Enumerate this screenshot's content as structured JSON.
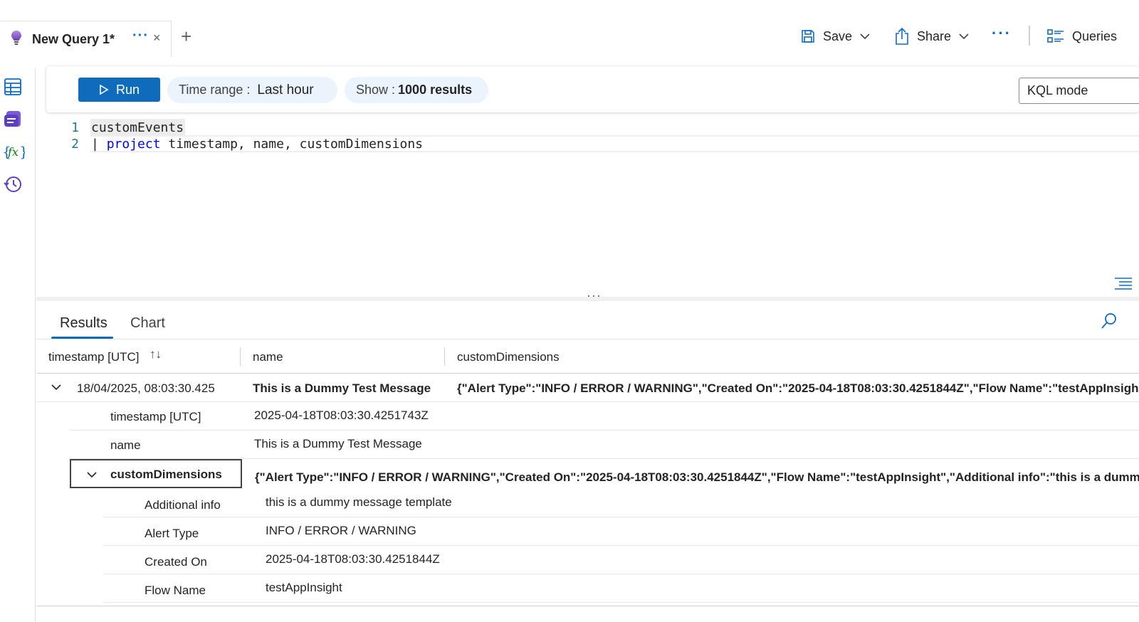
{
  "tab": {
    "title": "New Query 1*",
    "more": "···",
    "close": "×",
    "add": "+"
  },
  "toolbar": {
    "save": "Save",
    "share": "Share",
    "more": "···",
    "queries": "Queries"
  },
  "command": {
    "run": "Run",
    "time_label": "Time range :",
    "time_value": "Last hour",
    "show_label": "Show :",
    "show_value": "1000 results",
    "mode": "KQL mode"
  },
  "editor": {
    "lines": [
      {
        "num": "1",
        "text": "customEvents"
      },
      {
        "num": "2",
        "pipe": "| ",
        "keyword": "project",
        "rest": " timestamp, name, customDimensions"
      }
    ]
  },
  "results": {
    "tabs": [
      "Results",
      "Chart"
    ],
    "columns": [
      "timestamp [UTC]",
      "name",
      "customDimensions"
    ],
    "row": {
      "timestamp": "18/04/2025, 08:03:30.425",
      "name": "This is a Dummy Test Message",
      "customDimensions": "{\"Alert Type\":\"INFO / ERROR / WARNING\",\"Created On\":\"2025-04-18T08:03:30.4251844Z\",\"Flow Name\":\"testAppInsigh"
    },
    "details": [
      {
        "key": "timestamp [UTC]",
        "value": "2025-04-18T08:03:30.4251743Z"
      },
      {
        "key": "name",
        "value": "This is a Dummy Test Message"
      }
    ],
    "custom_dimensions": {
      "key": "customDimensions",
      "value": "{\"Alert Type\":\"INFO / ERROR / WARNING\",\"Created On\":\"2025-04-18T08:03:30.4251844Z\",\"Flow Name\":\"testAppInsight\",\"Additional info\":\"this is a dummy",
      "items": [
        {
          "key": "Additional info",
          "value": "this is a dummy message template"
        },
        {
          "key": "Alert Type",
          "value": "INFO / ERROR / WARNING"
        },
        {
          "key": "Created On",
          "value": "2025-04-18T08:03:30.4251844Z"
        },
        {
          "key": "Flow Name",
          "value": "testAppInsight"
        }
      ]
    }
  },
  "colors": {
    "accent": "#0f6cbd",
    "pill_bg": "#ebf3fc",
    "keyword": "#0000ff",
    "line_number": "#237893"
  },
  "icons": [
    "lightbulb-icon",
    "save-icon",
    "share-icon",
    "queries-icon",
    "table-icon",
    "tables-icon",
    "function-icon",
    "history-icon",
    "play-icon",
    "format-icon",
    "search-icon",
    "sort-icon",
    "chevron-down-icon"
  ]
}
